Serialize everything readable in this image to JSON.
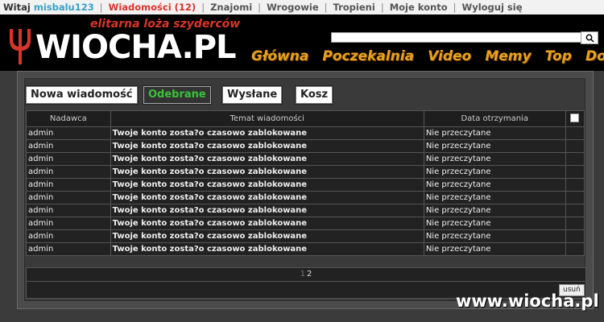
{
  "topbar": {
    "welcome": "Witaj",
    "username": "misbalu123",
    "links": [
      "Wiadomości (12)",
      "Znajomi",
      "Wrogowie",
      "Tropieni",
      "Moje konto",
      "Wyloguj się"
    ]
  },
  "header": {
    "tagline": "elitarna loża szyderców",
    "logo_text": "WIOCHA.PL",
    "nav": [
      "Główna",
      "Poczekalnia",
      "Video",
      "Memy",
      "Top",
      "Dodaj"
    ]
  },
  "messages": {
    "buttons": {
      "new": "Nowa wiadomość",
      "inbox": "Odebrane",
      "sent": "Wysłane",
      "trash": "Kosz"
    },
    "columns": [
      "Nadawca",
      "Temat wiadomości",
      "Data otrzymania"
    ],
    "rows": [
      {
        "sender": "admin",
        "subject": "Twoje konto zosta?o czasowo zablokowane",
        "date": "Nie przeczytane"
      },
      {
        "sender": "admin",
        "subject": "Twoje konto zosta?o czasowo zablokowane",
        "date": "Nie przeczytane"
      },
      {
        "sender": "admin",
        "subject": "Twoje konto zosta?o czasowo zablokowane",
        "date": "Nie przeczytane"
      },
      {
        "sender": "admin",
        "subject": "Twoje konto zosta?o czasowo zablokowane",
        "date": "Nie przeczytane"
      },
      {
        "sender": "admin",
        "subject": "Twoje konto zosta?o czasowo zablokowane",
        "date": "Nie przeczytane"
      },
      {
        "sender": "admin",
        "subject": "Twoje konto zosta?o czasowo zablokowane",
        "date": "Nie przeczytane"
      },
      {
        "sender": "admin",
        "subject": "Twoje konto zosta?o czasowo zablokowane",
        "date": "Nie przeczytane"
      },
      {
        "sender": "admin",
        "subject": "Twoje konto zosta?o czasowo zablokowane",
        "date": "Nie przeczytane"
      },
      {
        "sender": "admin",
        "subject": "Twoje konto zosta?o czasowo zablokowane",
        "date": "Nie przeczytane"
      },
      {
        "sender": "admin",
        "subject": "Twoje konto zosta?o czasowo zablokowane",
        "date": "Nie przeczytane"
      }
    ],
    "pages": [
      "1",
      "2"
    ],
    "delete_label": "usuń"
  },
  "watermark": "www.wiocha.pl",
  "colors": {
    "accent_nav": "#e8a222",
    "active_tab": "#3bc13b",
    "alert": "#d9352b"
  }
}
